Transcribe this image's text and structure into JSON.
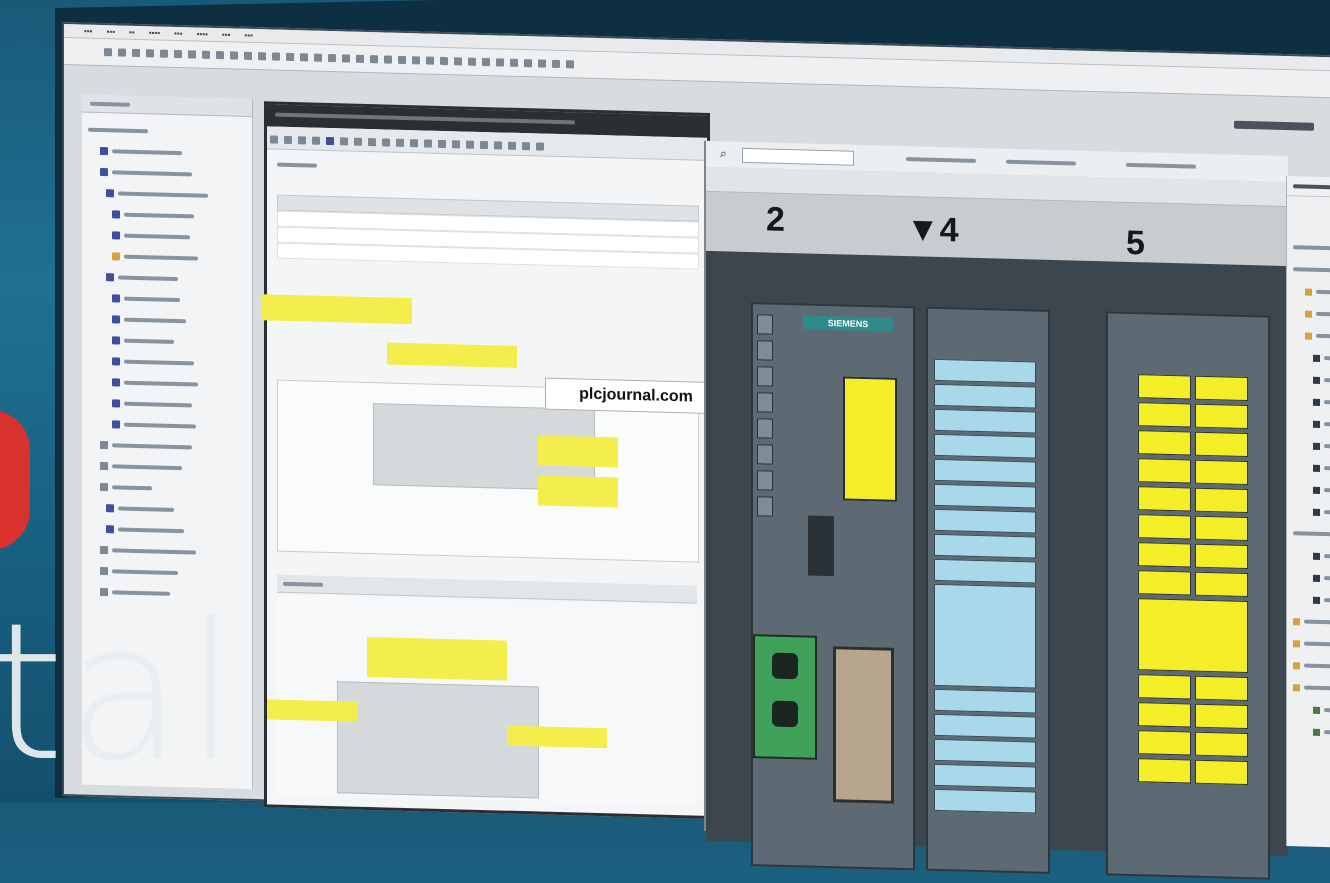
{
  "brand_overlay": {
    "text": "tal"
  },
  "watermark": {
    "text": "plcjournal.com"
  },
  "hw_view": {
    "slots": [
      "2",
      "▼4",
      "5"
    ],
    "cpu_label": "SIEMENS"
  },
  "colors": {
    "background": "#1f7093",
    "highlight_yellow": "#f4ee27",
    "io_blue": "#a9d8ea",
    "siemens_teal": "#2f8a8d",
    "badge_red": "#d9322e"
  },
  "icons": [
    "folder-icon",
    "cpu-icon",
    "module-icon",
    "search-icon"
  ]
}
